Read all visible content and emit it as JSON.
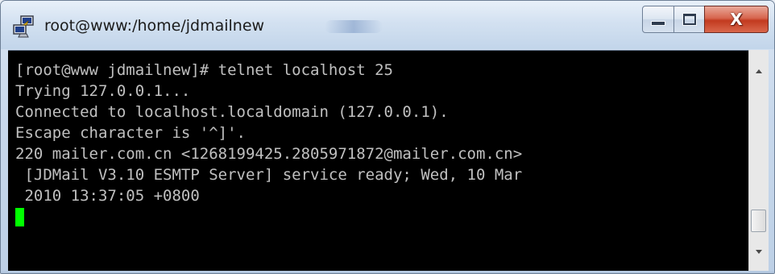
{
  "window": {
    "title": "root@www:/home/jdmailnew",
    "app_icon": "putty-icon",
    "controls": {
      "minimize": "minimize-icon",
      "maximize": "maximize-icon",
      "close": "close-icon",
      "close_glyph": "X"
    }
  },
  "terminal": {
    "lines": [
      "[root@www jdmailnew]# telnet localhost 25",
      "Trying 127.0.0.1...",
      "Connected to localhost.localdomain (127.0.0.1).",
      "Escape character is '^]'.",
      "220 mailer.com.cn <1268199425.2805971872@mailer.com.cn>",
      " [JDMail V3.10 ESMTP Server] service ready; Wed, 10 Mar",
      " 2010 13:37:05 +0800"
    ],
    "cursor_color": "#00ff00",
    "text_color": "#c0c0c0",
    "background": "#000000"
  },
  "scrollbar": {
    "up_icon": "scroll-up-arrow-icon",
    "down_icon": "scroll-down-arrow-icon"
  }
}
